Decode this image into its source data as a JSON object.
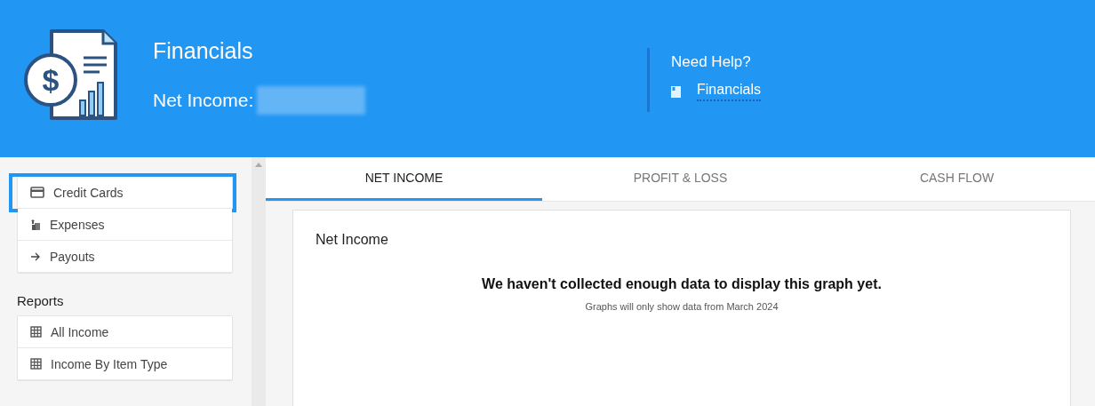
{
  "header": {
    "logo_symbol": "$",
    "title": "Financials",
    "net_income_label": "Net Income:",
    "net_income_redacted": true,
    "help": {
      "title": "Need Help?",
      "link": "Financials"
    }
  },
  "sidebar": {
    "groups": [
      {
        "items": [
          {
            "label": "Credit Cards",
            "kind": "card",
            "highlighted": true
          },
          {
            "label": "Expenses",
            "kind": "expenses",
            "highlighted": false
          },
          {
            "label": "Payouts",
            "kind": "arrow",
            "highlighted": false
          }
        ]
      },
      {
        "heading": "Reports",
        "items": [
          {
            "label": "All Income",
            "kind": "grid",
            "highlighted": false
          },
          {
            "label": "Income By Item Type",
            "kind": "grid",
            "highlighted": false
          }
        ]
      }
    ]
  },
  "tabs": [
    {
      "label": "NET INCOME",
      "selected": true
    },
    {
      "label": "PROFIT & LOSS",
      "selected": false
    },
    {
      "label": "CASH FLOW",
      "selected": false
    }
  ],
  "panel": {
    "title": "Net Income",
    "message": "We haven't collected enough data to display this graph yet.",
    "note": "Graphs will only show data from March 2024"
  }
}
